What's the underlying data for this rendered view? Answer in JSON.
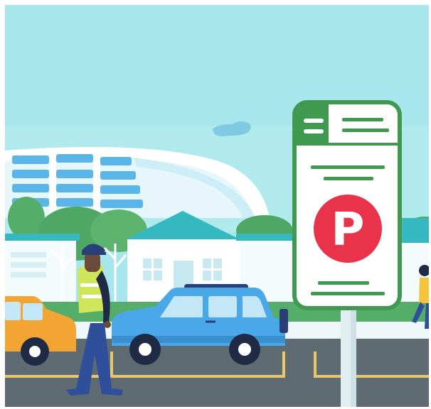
{
  "scene": {
    "sign": {
      "letter": "P",
      "letter_color": "#ffffff",
      "badge_color": "#e8334a",
      "frame_color": "#3f9a4f"
    },
    "colors": {
      "sky": "#a6e6ec",
      "road": "#5f6b73",
      "lane_line": "#e9c66a",
      "hedge": "#55ad6a",
      "roof": "#35b8bf",
      "car_blue": "#4aa8e8",
      "car_orange": "#f3a534"
    }
  }
}
